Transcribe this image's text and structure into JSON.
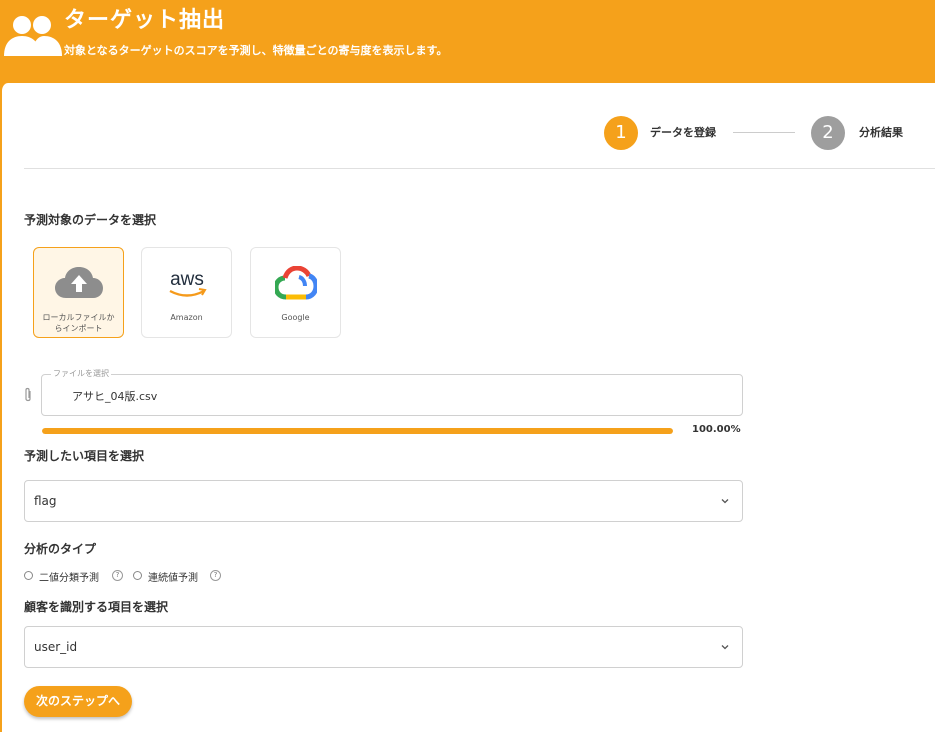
{
  "header": {
    "title": "ターゲット抽出",
    "subtitle": "対象となるターゲットのスコアを予測し、特徴量ごとの寄与度を表示します。",
    "icon": "users-icon"
  },
  "stepper": {
    "steps": [
      {
        "number": "1",
        "label": "データを登録",
        "state": "active"
      },
      {
        "number": "2",
        "label": "分析結果",
        "state": "inactive"
      }
    ]
  },
  "data_source": {
    "label": "予測対象のデータを選択",
    "tiles": [
      {
        "label": "ローカルファイルからインポート",
        "icon": "cloud-upload-icon",
        "selected": true
      },
      {
        "label": "Amazon",
        "icon": "aws-logo",
        "logo_text": "aws",
        "selected": false
      },
      {
        "label": "Google",
        "icon": "google-cloud-logo",
        "selected": false
      }
    ]
  },
  "file": {
    "legend": "ファイルを選択",
    "value": "アサヒ_04版.csv",
    "progress_percent": 100,
    "progress_text": "100.00%"
  },
  "target_item": {
    "label": "予測したい項目を選択",
    "value": "flag"
  },
  "analysis_type": {
    "label": "分析のタイプ",
    "options": [
      {
        "label": "二値分類予測",
        "checked": false
      },
      {
        "label": "連続値予測",
        "checked": false
      }
    ],
    "help_glyph": "?"
  },
  "customer_id": {
    "label": "顧客を識別する項目を選択",
    "value": "user_id"
  },
  "next_button": {
    "label": "次のステップへ"
  },
  "colors": {
    "accent": "#f5a11b",
    "inactive_step": "#9e9e9e"
  }
}
